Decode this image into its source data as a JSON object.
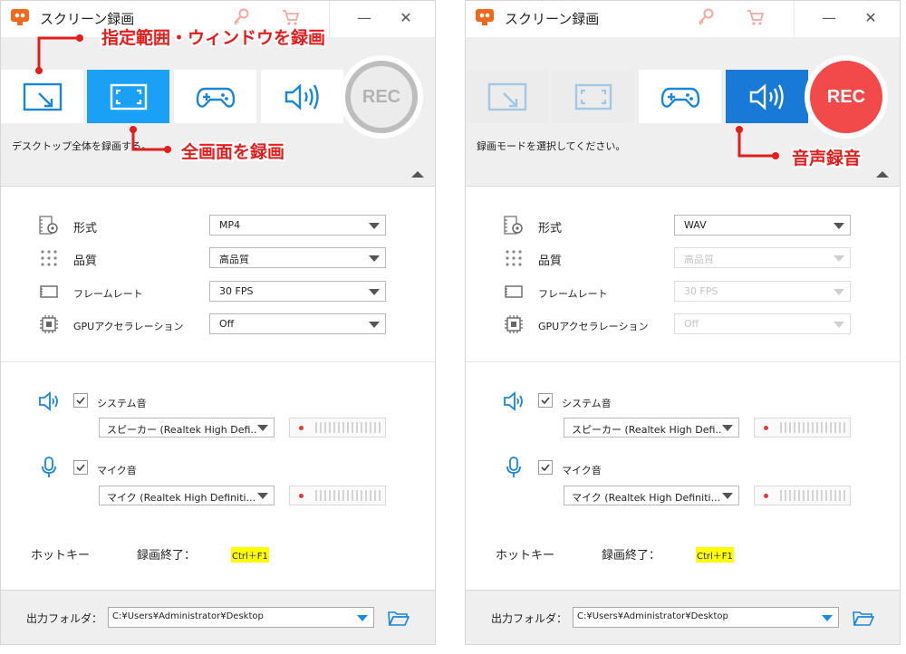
{
  "windows": [
    {
      "title": "スクリーン録画",
      "description": "デスクトップ全体を録画する。",
      "rec_label": "REC",
      "rec_state": "idle",
      "modes": [
        {
          "name": "region",
          "state": "normal"
        },
        {
          "name": "fullscreen",
          "state": "active"
        },
        {
          "name": "game",
          "state": "normal"
        },
        {
          "name": "audio",
          "state": "normal"
        }
      ],
      "settings": {
        "format_label": "形式",
        "format_value": "MP4",
        "format_enabled": true,
        "quality_label": "品質",
        "quality_value": "高品質",
        "quality_enabled": true,
        "framerate_label": "フレームレート",
        "framerate_value": "30 FPS",
        "framerate_enabled": true,
        "gpu_label": "GPUアクセラレーション",
        "gpu_value": "Off",
        "gpu_enabled": true
      },
      "audio": {
        "system_label": "システム音",
        "system_checked": true,
        "system_device": "スピーカー (Realtek High Defi...",
        "mic_label": "マイク音",
        "mic_checked": true,
        "mic_device": "マイク (Realtek High Definiti..."
      },
      "hotkey": {
        "label": "ホットキー",
        "action": "録画終了：",
        "key": "Ctrl＋F1"
      },
      "output": {
        "label": "出力フォルダ：",
        "path": "C:¥Users¥Administrator¥Desktop"
      },
      "callouts": [
        "指定範囲・ウィンドウを録画",
        "全画面を録画"
      ]
    },
    {
      "title": "スクリーン録画",
      "description": "録画モードを選択してください。",
      "rec_label": "REC",
      "rec_state": "live",
      "modes": [
        {
          "name": "region",
          "state": "disabled"
        },
        {
          "name": "fullscreen",
          "state": "disabled"
        },
        {
          "name": "game",
          "state": "normal"
        },
        {
          "name": "audio",
          "state": "active"
        }
      ],
      "settings": {
        "format_label": "形式",
        "format_value": "WAV",
        "format_enabled": true,
        "quality_label": "品質",
        "quality_value": "高品質",
        "quality_enabled": false,
        "framerate_label": "フレームレート",
        "framerate_value": "30 FPS",
        "framerate_enabled": false,
        "gpu_label": "GPUアクセラレーション",
        "gpu_value": "Off",
        "gpu_enabled": false
      },
      "audio": {
        "system_label": "システム音",
        "system_checked": true,
        "system_device": "スピーカー (Realtek High Defi...",
        "mic_label": "マイク音",
        "mic_checked": true,
        "mic_device": "マイク (Realtek High Definiti..."
      },
      "hotkey": {
        "label": "ホットキー",
        "action": "録画終了：",
        "key": "Ctrl＋F1"
      },
      "output": {
        "label": "出力フォルダ：",
        "path": "C:¥Users¥Administrator¥Desktop"
      },
      "callouts": [
        "音声録音"
      ]
    }
  ],
  "colors": {
    "accent": "#1aa0f5",
    "accent_dark": "#1879d6",
    "rec_live": "#f24a4a",
    "callout": "#e31c1c",
    "hotkey_bg": "#ffff00"
  }
}
